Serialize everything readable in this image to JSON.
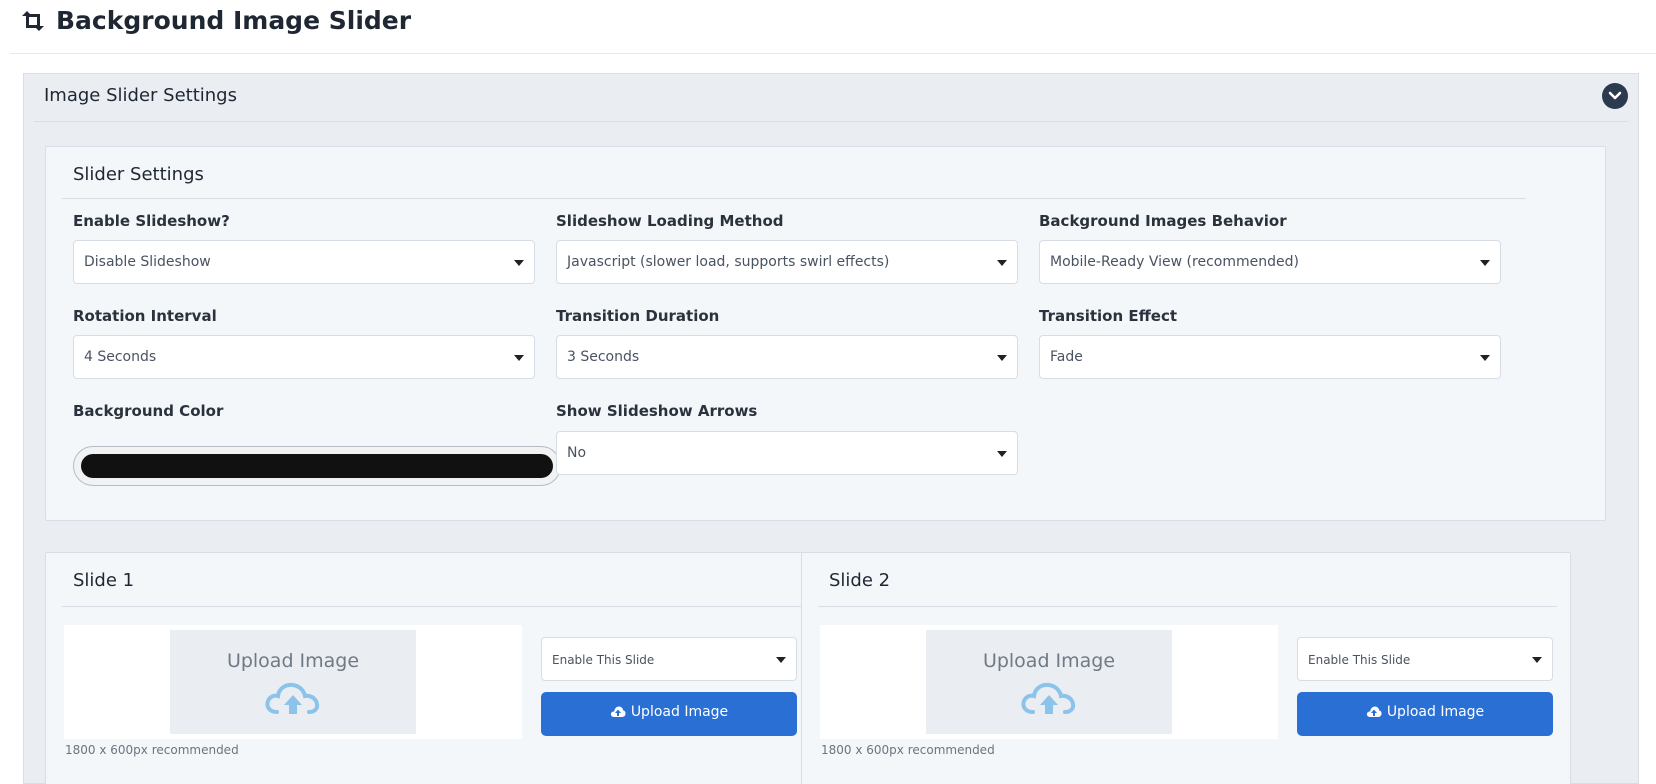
{
  "page": {
    "title": "Background Image Slider"
  },
  "panel": {
    "title": "Image Slider Settings"
  },
  "slider_settings": {
    "title": "Slider Settings",
    "fields": {
      "enable_slideshow": {
        "label": "Enable Slideshow?",
        "value": "Disable Slideshow"
      },
      "loading_method": {
        "label": "Slideshow Loading Method",
        "value": "Javascript (slower load, supports swirl effects)"
      },
      "images_behavior": {
        "label": "Background Images Behavior",
        "value": "Mobile-Ready View (recommended)"
      },
      "rotation_interval": {
        "label": "Rotation Interval",
        "value": "4 Seconds"
      },
      "transition_duration": {
        "label": "Transition Duration",
        "value": "3 Seconds"
      },
      "transition_effect": {
        "label": "Transition Effect",
        "value": "Fade"
      },
      "background_color": {
        "label": "Background Color",
        "value": "#111111"
      },
      "show_arrows": {
        "label": "Show Slideshow Arrows",
        "value": "No"
      }
    }
  },
  "slides": [
    {
      "title": "Slide 1",
      "placeholder_text": "Upload Image",
      "recommendation": "1800 x 600px recommended",
      "status": "Enable This Slide",
      "upload_label": "Upload Image"
    },
    {
      "title": "Slide 2",
      "placeholder_text": "Upload Image",
      "recommendation": "1800 x 600px recommended",
      "status": "Enable This Slide",
      "upload_label": "Upload Image"
    }
  ],
  "colors": {
    "accent_button": "#2a6fd4",
    "panel_background": "#eaeef3",
    "collapse_button": "#2b3a4f",
    "upload_cloud": "#8cc3ea"
  },
  "icons": {
    "header": "retweet-icon",
    "collapse": "chevron-down-icon",
    "placeholder": "cloud-upload-icon",
    "button": "cloud-upload-icon"
  }
}
